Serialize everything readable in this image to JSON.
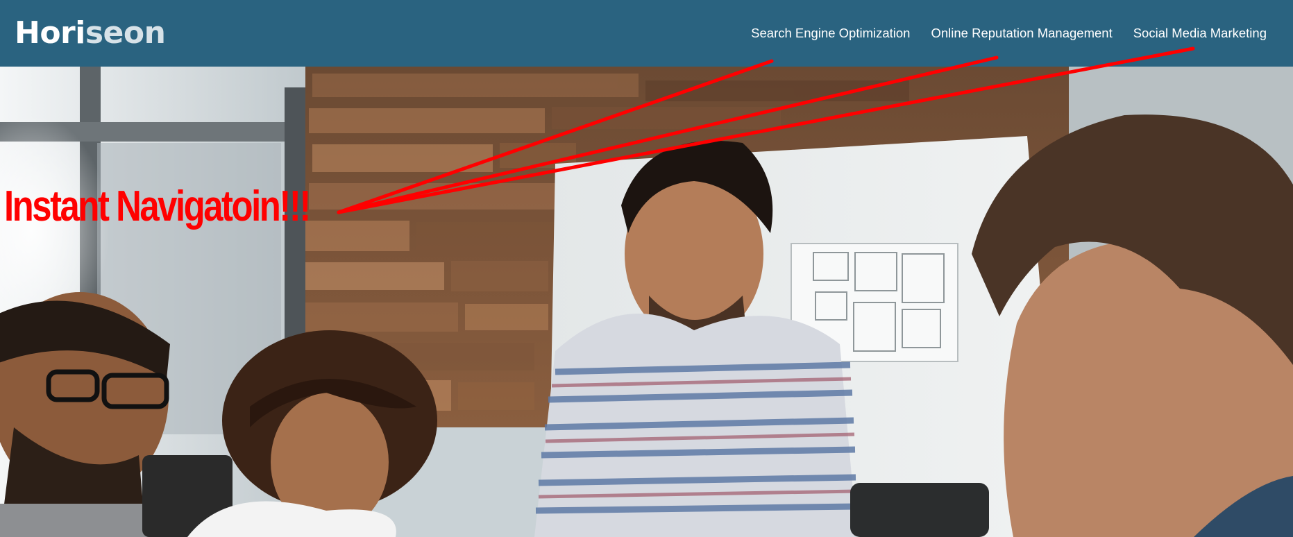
{
  "header": {
    "logo_part1": "Hori",
    "logo_part2": "seon",
    "nav": [
      {
        "label": "Search Engine Optimization"
      },
      {
        "label": "Online Reputation Management"
      },
      {
        "label": "Social Media Marketing"
      }
    ]
  },
  "annotation": {
    "text": "Instant Navigatoin!!!",
    "color": "#ff0000"
  },
  "colors": {
    "header_bg": "#2a6380",
    "nav_text": "#ffffff"
  },
  "hero": {
    "icon": "team-meeting-photo"
  }
}
